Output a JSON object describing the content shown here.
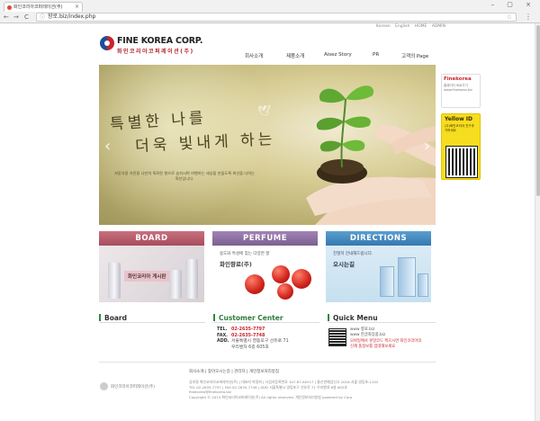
{
  "browser": {
    "tab_title": "화인코리아코퍼레이션(주)",
    "tab_close": "×",
    "url": "향로.biz/index.php",
    "window_controls": "– ▢ ×",
    "nav": {
      "back": "←",
      "forward": "→",
      "reload": "C"
    }
  },
  "toplinks": [
    "Korean",
    "English",
    "HOME",
    "ADMIN"
  ],
  "logo": {
    "en": "FINE KOREA CORP.",
    "kr": "화인코리아코퍼레이션(주)"
  },
  "gnb": [
    "회사소개",
    "제품소개",
    "Aisez Story",
    "PR",
    "고객의 Page"
  ],
  "hero": {
    "line1": "특별한 나를",
    "line2": "더욱 빛내게 하는",
    "caption": "자동차용 가전용 나만의 특화된 향으로 숨쉬시며 여행하는 세상을 만들도록 최선을 다하는 화인입니다.",
    "prev": "‹",
    "next": "›"
  },
  "side": {
    "finekorea": {
      "title": "Finekorea",
      "sub": "홈페이지 바로가기 www.finekorea.biz"
    },
    "yellowid": {
      "title": "Yellow ID",
      "sub": "(주)화인코리아 친구추가하세요"
    }
  },
  "banners": {
    "board": {
      "title": "BOARD",
      "label": "화인코리아 게시판"
    },
    "perfume": {
      "title": "PERFUME",
      "line1": "용도와 특성에 맞는 다양한 향",
      "line2": "화인향료(주)"
    },
    "directions": {
      "title": "DIRECTIONS",
      "line1": "친절히 안내해드립니다.",
      "line2": "오시는길"
    }
  },
  "sections": {
    "board": "Board",
    "customer": "Customer Center",
    "quick": "Quick Menu"
  },
  "customer": {
    "tel_k": "TEL.",
    "tel_v": "02-2635-7797",
    "fax_k": "FAX.",
    "fax_v": "02-2635-7748",
    "add_k": "ADD.",
    "add_v1": "서울특별시 영등포구 선유로 71",
    "add_v2": "우리벤처 6층 605호"
  },
  "quick": {
    "l1": "www 향료.biz",
    "l2": "www 한글화장품.biz",
    "l3": "모바일에서 큐알코드 찍으시면 화인코리아의",
    "l4": "신제 품정보를 업데해보세요"
  },
  "footer": {
    "links": "회사소개 | 찾아오시는길 | 관리자 | 개인정보처리방침",
    "logo_text": "화인코리아코퍼레이션(주)",
    "info1": "상호명 화인코리아코퍼레이션(주) | 대표자 박정희 | 사업자등록번호 107-87-80517 | 통신판매업신고 2016-서울 영등포-1102",
    "info2": "TEL 02-2635-7797 | FAX 02-2635-7748 | ADD 서울특별시 영등포구 선유로 71 우리벤처 6층 605호",
    "info3": "finekorea@finekorea.biz",
    "info4": "Copyright © 2015 화인코리아코퍼레이션(주) All rights reserved. 개인정보처리방침 powered by Corp"
  }
}
